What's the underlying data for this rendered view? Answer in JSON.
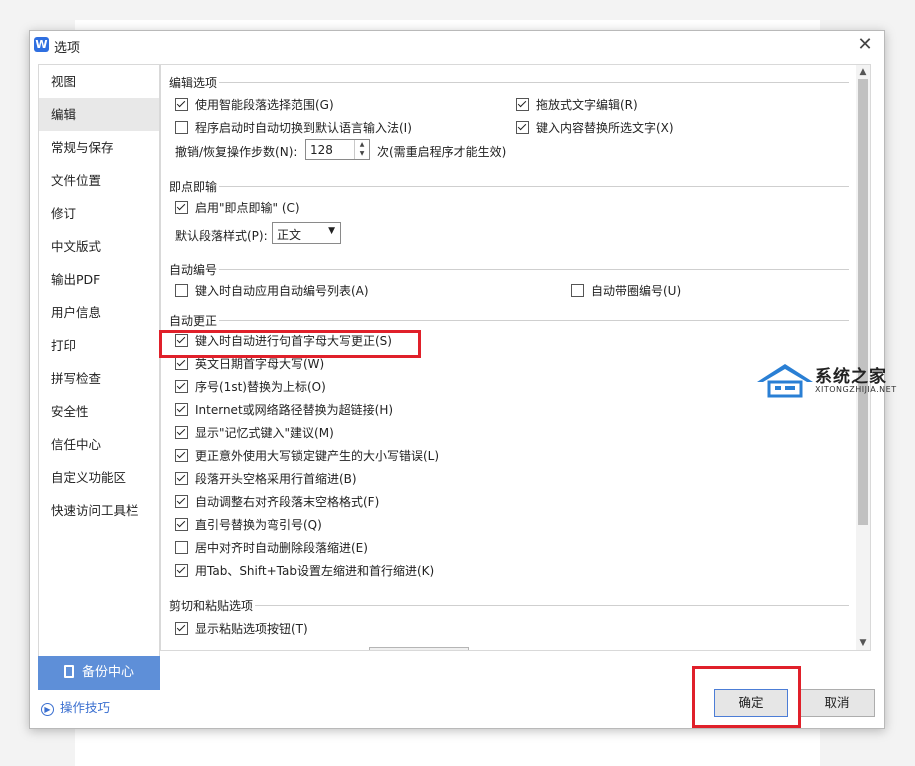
{
  "window": {
    "title": "选项",
    "app_icon": "W"
  },
  "sidebar": {
    "items": [
      {
        "label": "视图",
        "active": false
      },
      {
        "label": "编辑",
        "active": true
      },
      {
        "label": "常规与保存",
        "active": false
      },
      {
        "label": "文件位置",
        "active": false
      },
      {
        "label": "修订",
        "active": false
      },
      {
        "label": "中文版式",
        "active": false
      },
      {
        "label": "输出PDF",
        "active": false
      },
      {
        "label": "用户信息",
        "active": false
      },
      {
        "label": "打印",
        "active": false
      },
      {
        "label": "拼写检查",
        "active": false
      },
      {
        "label": "安全性",
        "active": false
      },
      {
        "label": "信任中心",
        "active": false
      },
      {
        "label": "自定义功能区",
        "active": false
      },
      {
        "label": "快速访问工具栏",
        "active": false
      }
    ],
    "backup_label": "备份中心",
    "tips_label": "操作技巧"
  },
  "sections": {
    "edit": {
      "title": "编辑选项",
      "smart_select": {
        "label": "使用智能段落选择范围(G)",
        "checked": true
      },
      "drag_text": {
        "label": "拖放式文字编辑(R)",
        "checked": true
      },
      "auto_ime": {
        "label": "程序启动时自动切换到默认语言输入法(I)",
        "checked": false
      },
      "replace_sel": {
        "label": "键入内容替换所选文字(X)",
        "checked": true
      },
      "undo_label": "撤销/恢复操作步数(N):",
      "undo_value": "128",
      "undo_note": "次(需重启程序才能生效)"
    },
    "click_type": {
      "title": "即点即输",
      "enable": {
        "label": "启用\"即点即输\" (C)",
        "checked": true
      },
      "style_label": "默认段落样式(P):",
      "style_value": "正文"
    },
    "auto_number": {
      "title": "自动编号",
      "auto_list": {
        "label": "键入时自动应用自动编号列表(A)",
        "checked": false
      },
      "circle_num": {
        "label": "自动带圈编号(U)",
        "checked": false
      }
    },
    "auto_correct": {
      "title": "自动更正",
      "items": [
        {
          "label": "键入时自动进行句首字母大写更正(S)",
          "checked": true
        },
        {
          "label": "英文日期首字母大写(W)",
          "checked": true
        },
        {
          "label": "序号(1st)替换为上标(O)",
          "checked": true
        },
        {
          "label": "Internet或网络路径替换为超链接(H)",
          "checked": true
        },
        {
          "label": "显示\"记忆式键入\"建议(M)",
          "checked": true
        },
        {
          "label": "更正意外使用大写锁定键产生的大小写错误(L)",
          "checked": true
        },
        {
          "label": "段落开头空格采用行首缩进(B)",
          "checked": true
        },
        {
          "label": "自动调整右对齐段落末空格格式(F)",
          "checked": true
        },
        {
          "label": "直引号替换为弯引号(Q)",
          "checked": true
        },
        {
          "label": "居中对齐时自动删除段落缩进(E)",
          "checked": false
        },
        {
          "label": "用Tab、Shift+Tab设置左缩进和首行缩进(K)",
          "checked": true
        }
      ]
    },
    "paste": {
      "title": "剪切和粘贴选项",
      "show_paste": {
        "label": "显示粘贴选项按钮(T)",
        "checked": true
      }
    }
  },
  "buttons": {
    "ok": "确定",
    "cancel": "取消"
  },
  "watermark": {
    "text": "系统之家",
    "sub": "XITONGZHIJIA.NET"
  },
  "colors": {
    "highlight": "#e0202a",
    "accent": "#5e8fd8",
    "link": "#3a6fd0"
  }
}
